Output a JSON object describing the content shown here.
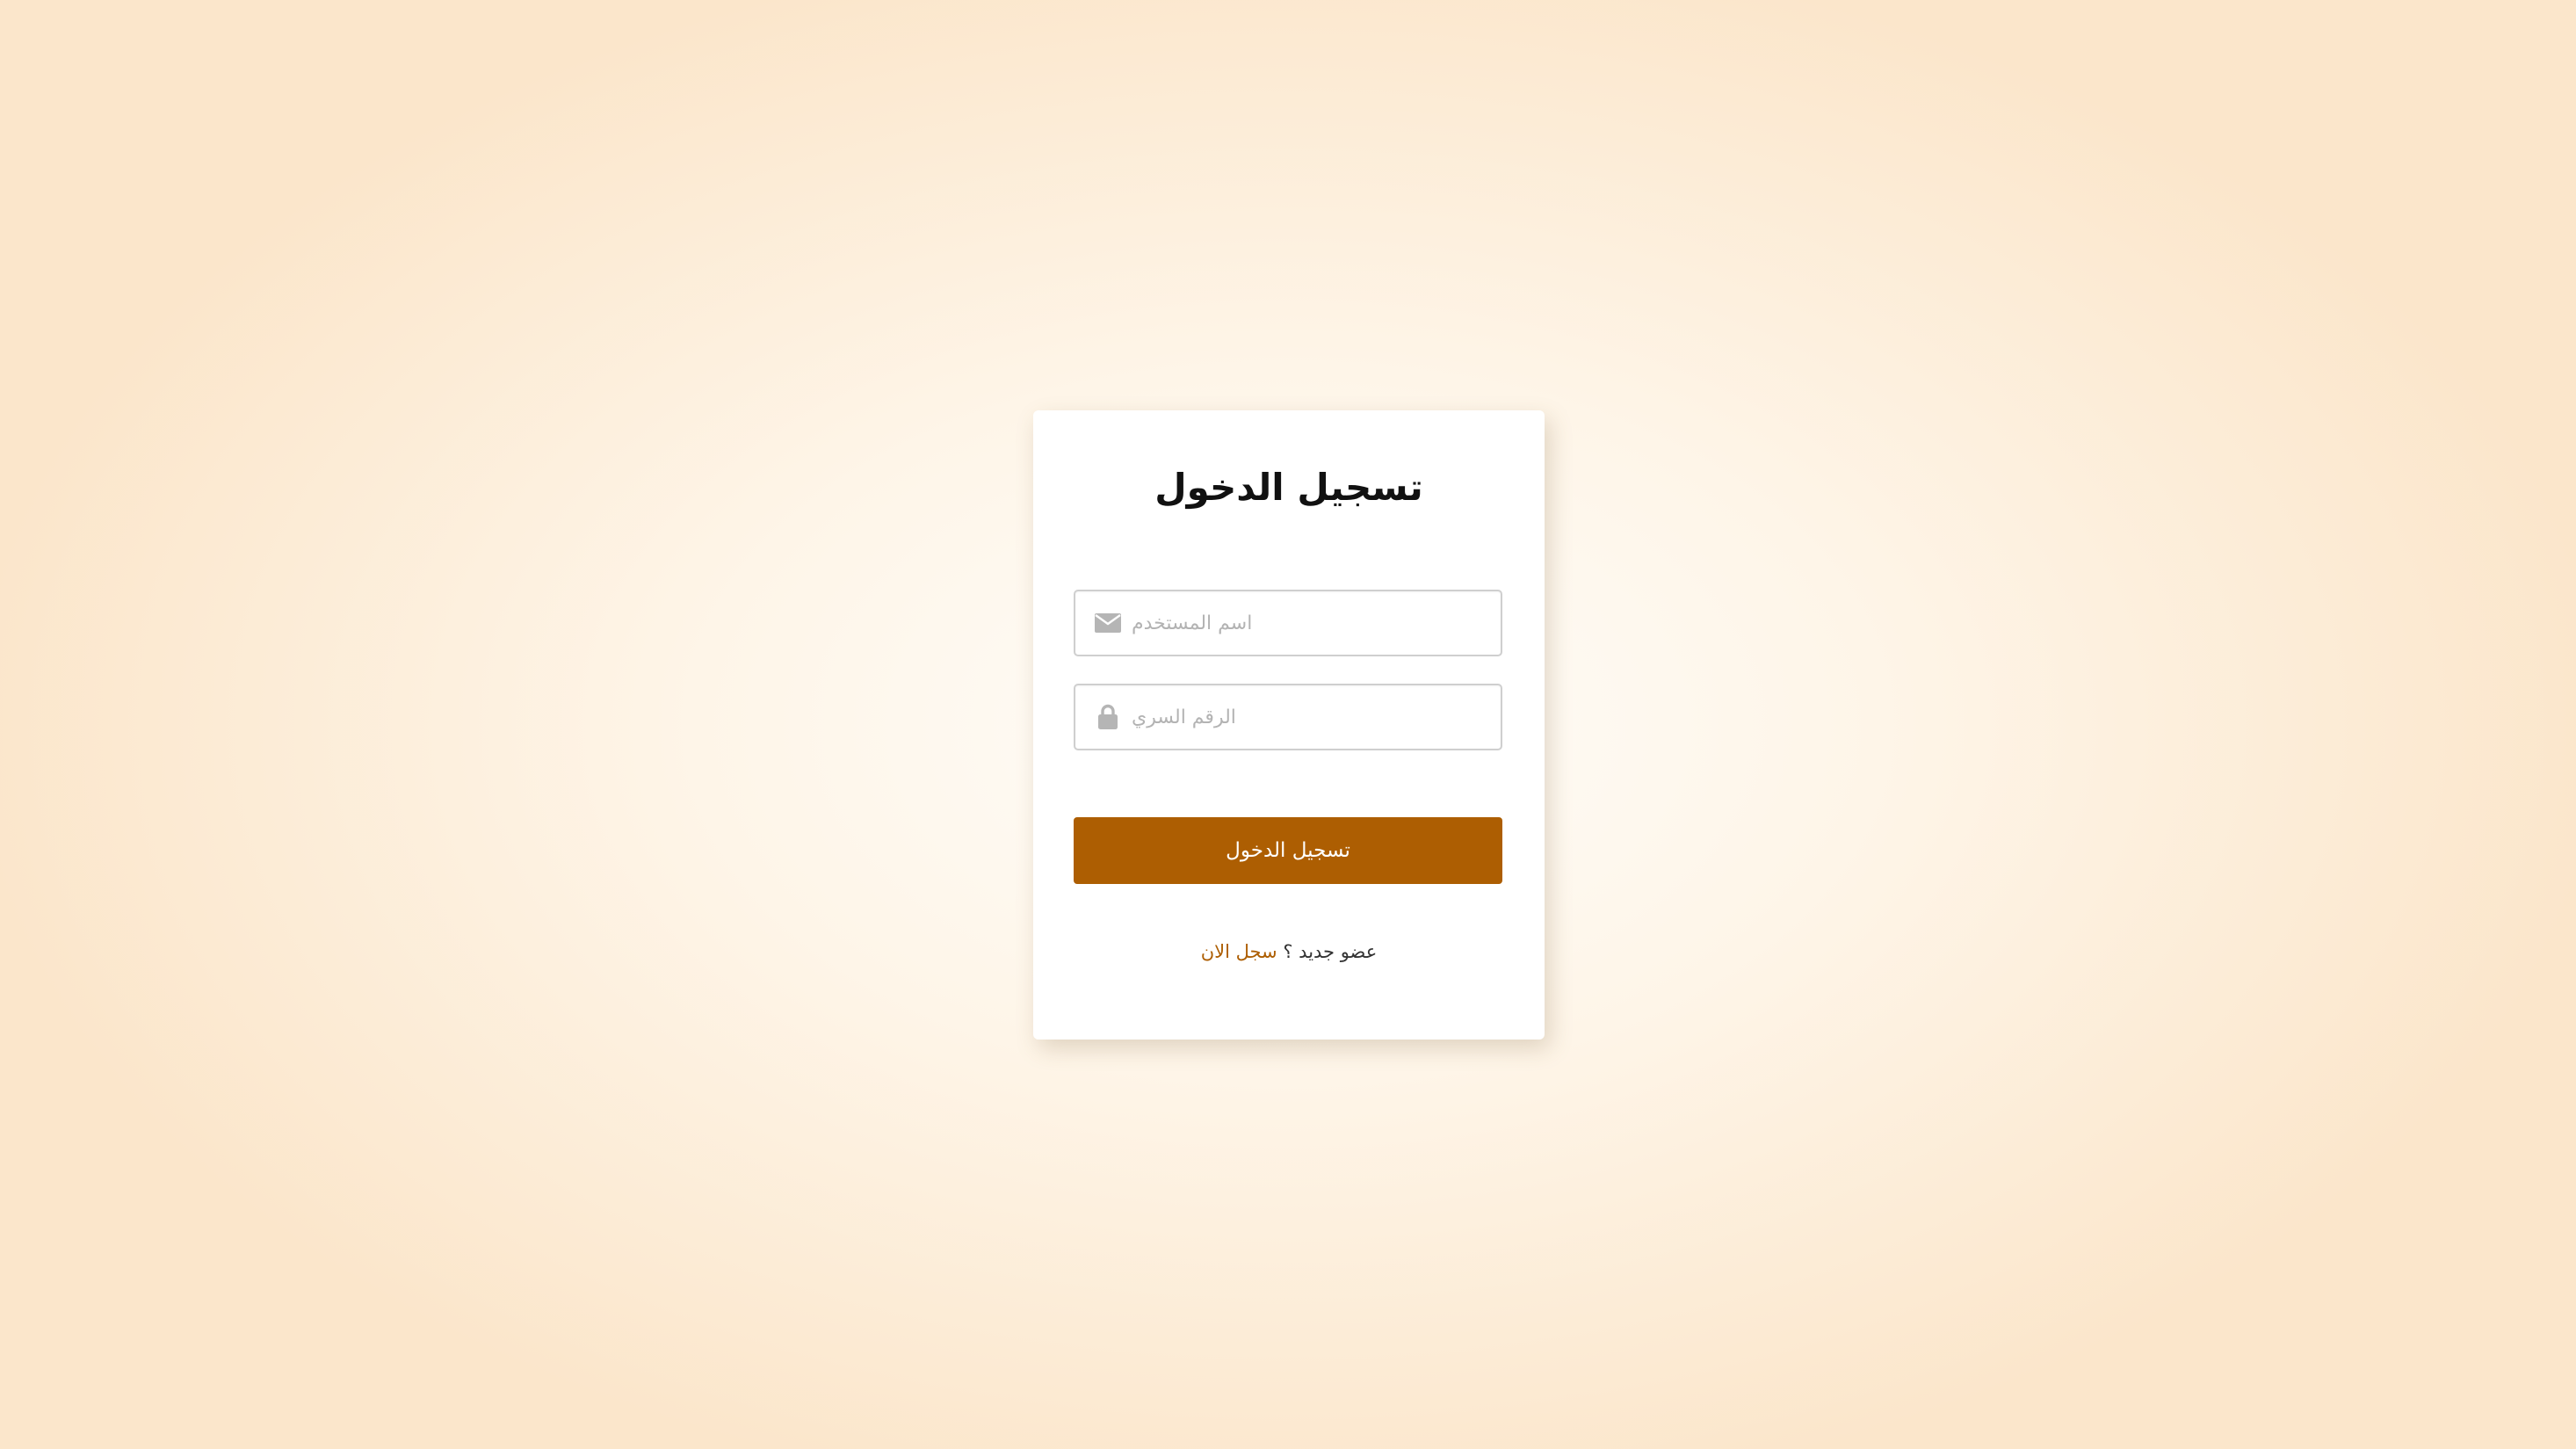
{
  "login": {
    "title": "تسجيل الدخول",
    "username": {
      "value": "",
      "placeholder": "اسم المستخدم",
      "icon": "envelope-icon"
    },
    "password": {
      "value": "",
      "placeholder": "الرقم السري",
      "icon": "lock-icon"
    },
    "submit_label": "تسجيل الدخول",
    "register_prompt": "عضو جديد ؟",
    "register_link": "سجل الان"
  },
  "colors": {
    "accent": "#ad5e02",
    "background_edge": "#fbe6cb",
    "background_center": "#fffdf9",
    "icon_gray": "#b5b5b5"
  }
}
